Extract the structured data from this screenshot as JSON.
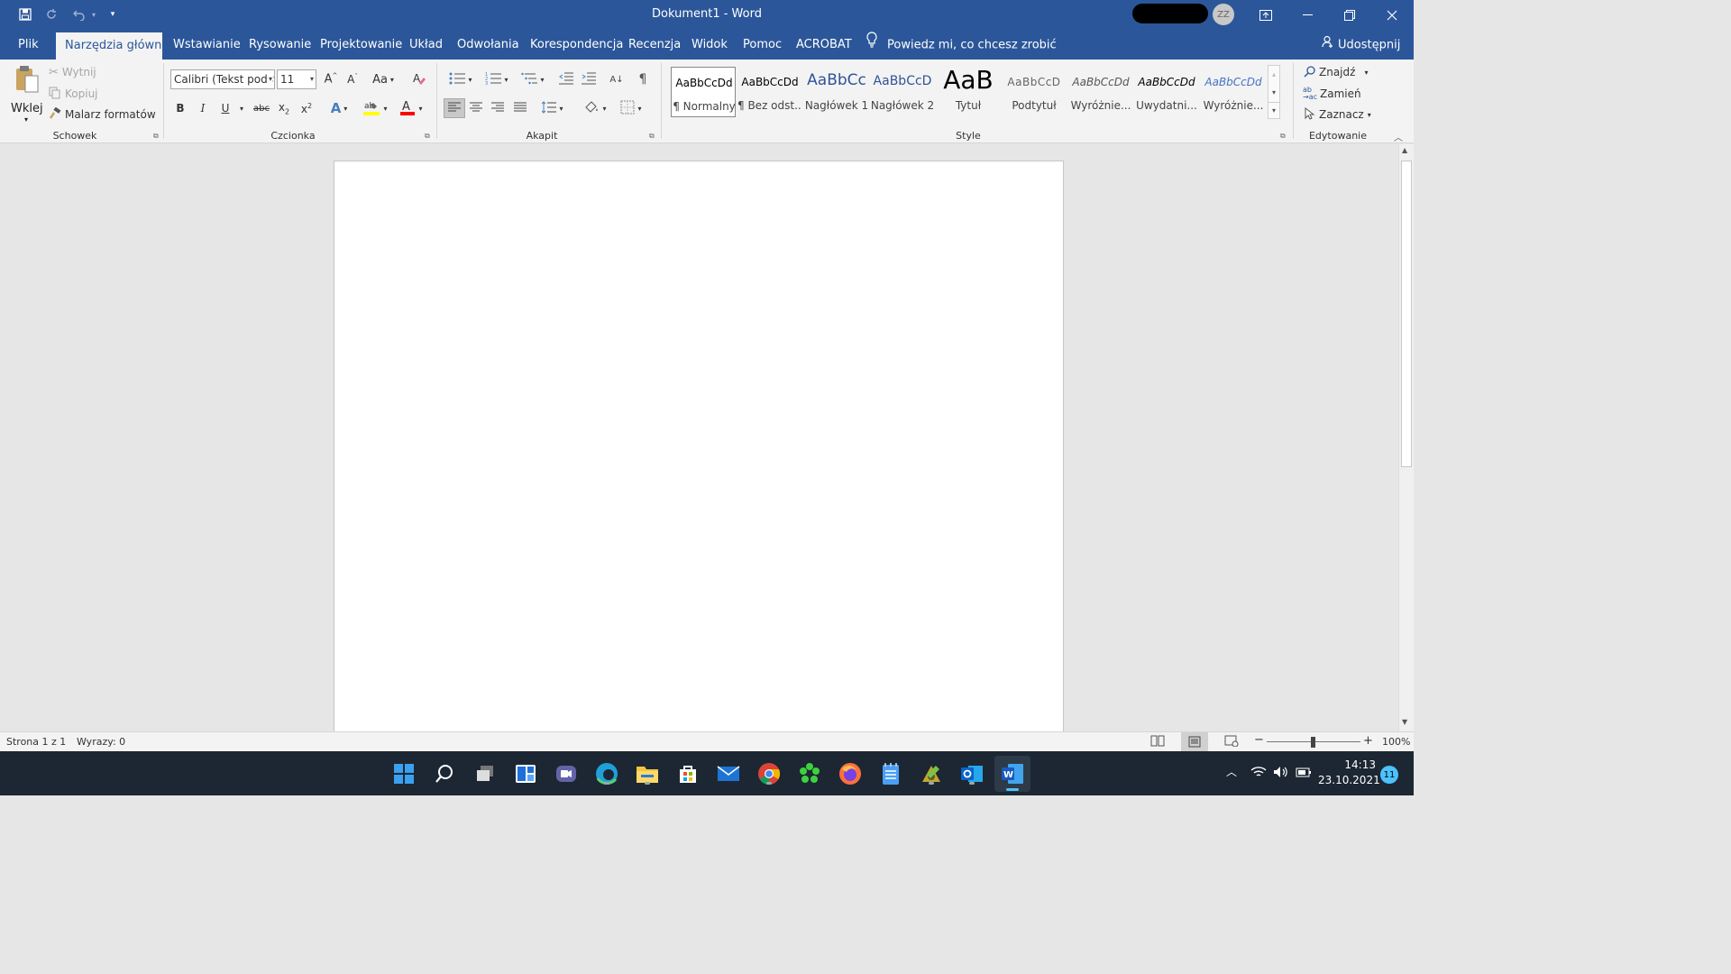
{
  "app": {
    "title": "Dokument1  -  Word",
    "avatar_initials": "ZZ"
  },
  "tabs": [
    {
      "label": "Plik"
    },
    {
      "label": "Narzędzia główne"
    },
    {
      "label": "Wstawianie"
    },
    {
      "label": "Rysowanie"
    },
    {
      "label": "Projektowanie"
    },
    {
      "label": "Układ"
    },
    {
      "label": "Odwołania"
    },
    {
      "label": "Korespondencja"
    },
    {
      "label": "Recenzja"
    },
    {
      "label": "Widok"
    },
    {
      "label": "Pomoc"
    },
    {
      "label": "ACROBAT"
    }
  ],
  "active_tab": "Narzędzia główne",
  "tell_me": "Powiedz mi, co chcesz zrobić",
  "share": "Udostępnij",
  "clipboard": {
    "paste": "Wklej",
    "cut": "Wytnij",
    "copy": "Kopiuj",
    "format_painter": "Malarz formatów",
    "group_label": "Schowek"
  },
  "font": {
    "name": "Calibri (Tekst podstawowy)",
    "size": "11",
    "change_case": "Aa",
    "group_label": "Czcionka"
  },
  "paragraph": {
    "group_label": "Akapit"
  },
  "styles": {
    "items": [
      {
        "sample": "AaBbCcDd",
        "name": "¶ Normalny"
      },
      {
        "sample": "AaBbCcDd",
        "name": "¶ Bez odst..."
      },
      {
        "sample": "AaBbCc",
        "name": "Nagłówek 1"
      },
      {
        "sample": "AaBbCcD",
        "name": "Nagłówek 2"
      },
      {
        "sample": "AaB",
        "name": "Tytuł"
      },
      {
        "sample": "AaBbCcD",
        "name": "Podtytuł"
      },
      {
        "sample": "AaBbCcDd",
        "name": "Wyróżnie..."
      },
      {
        "sample": "AaBbCcDd",
        "name": "Uwydatni..."
      },
      {
        "sample": "AaBbCcDd",
        "name": "Wyróżnie..."
      }
    ],
    "group_label": "Style"
  },
  "editing": {
    "find": "Znajdź",
    "replace": "Zamień",
    "select": "Zaznacz",
    "group_label": "Edytowanie"
  },
  "status": {
    "page": "Strona 1 z 1",
    "words": "Wyrazy: 0",
    "zoom": "100%",
    "zoom_minus": "−",
    "zoom_plus": "+"
  },
  "taskbar": {
    "time": "14:13",
    "date": "23.10.2021",
    "notifications": "11"
  },
  "colors": {
    "word_blue": "#2b579a",
    "highlight_yellow": "#ffff00",
    "font_red": "#ff0000"
  }
}
